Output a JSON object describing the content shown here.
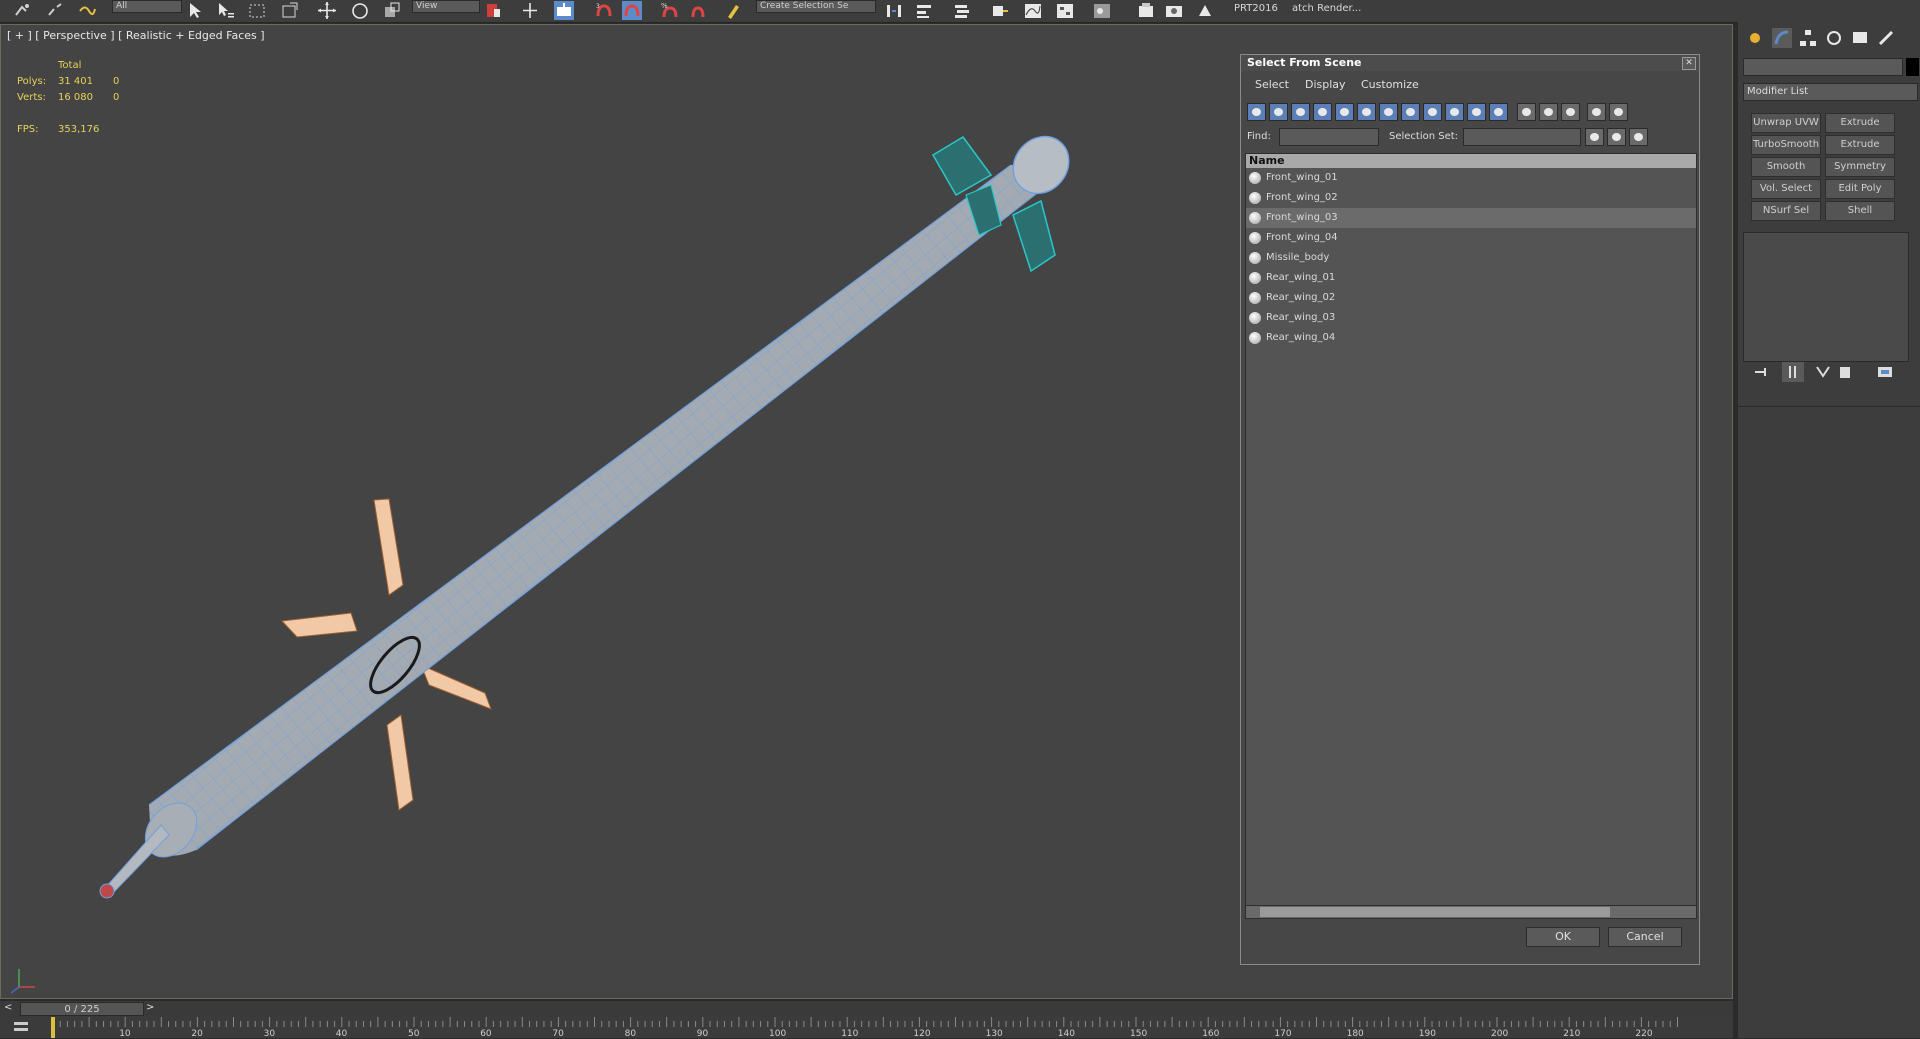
{
  "toolbar": {
    "selection_filter": "All",
    "ref_coord": "View",
    "named_selection": "Create Selection Se",
    "prt_label": "PRT2016",
    "batch_render_label": "atch Render..."
  },
  "viewport": {
    "label": "[ + ] [ Perspective ] [ Realistic + Edged Faces ]",
    "stats": {
      "header": "Total",
      "polys_label": "Polys:",
      "polys_total": "31 401",
      "polys_sel": "0",
      "verts_label": "Verts:",
      "verts_total": "16 080",
      "verts_sel": "0",
      "fps_label": "FPS:",
      "fps_value": "353,176"
    }
  },
  "dialog": {
    "title": "Select From Scene",
    "close_glyph": "✕",
    "menu": [
      "Select",
      "Display",
      "Customize"
    ],
    "find_label": "Find:",
    "selection_set_label": "Selection Set:",
    "list_header": "Name",
    "rows": [
      {
        "name": "Front_wing_01",
        "selected": false
      },
      {
        "name": "Front_wing_02",
        "selected": false
      },
      {
        "name": "Front_wing_03",
        "selected": true
      },
      {
        "name": "Front_wing_04",
        "selected": false
      },
      {
        "name": "Missile_body",
        "selected": false
      },
      {
        "name": "Rear_wing_01",
        "selected": false
      },
      {
        "name": "Rear_wing_02",
        "selected": false
      },
      {
        "name": "Rear_wing_03",
        "selected": false
      },
      {
        "name": "Rear_wing_04",
        "selected": false
      }
    ],
    "ok_label": "OK",
    "cancel_label": "Cancel"
  },
  "command_panel": {
    "modifier_list": "Modifier List",
    "modifier_buttons": [
      [
        "Unwrap UVW",
        "Extrude"
      ],
      [
        "TurboSmooth",
        "Extrude"
      ],
      [
        "Smooth",
        "Symmetry"
      ],
      [
        "Vol. Select",
        "Edit Poly"
      ],
      [
        "NSurf Sel",
        "Shell"
      ]
    ]
  },
  "timeline": {
    "frame_display": "0 / 225",
    "ticks": [
      "10",
      "20",
      "30",
      "40",
      "50",
      "60",
      "70",
      "80",
      "90",
      "100",
      "110",
      "120",
      "130",
      "140",
      "150",
      "160",
      "170",
      "180",
      "190",
      "200",
      "210",
      "220"
    ]
  },
  "colors": {
    "viewport_bg": "#444444",
    "stats_text": "#e5d35a",
    "mesh_wire": "#6fa0e0",
    "selected_wire": "#28c8c8",
    "rear_wing": "#f2c9a6"
  }
}
